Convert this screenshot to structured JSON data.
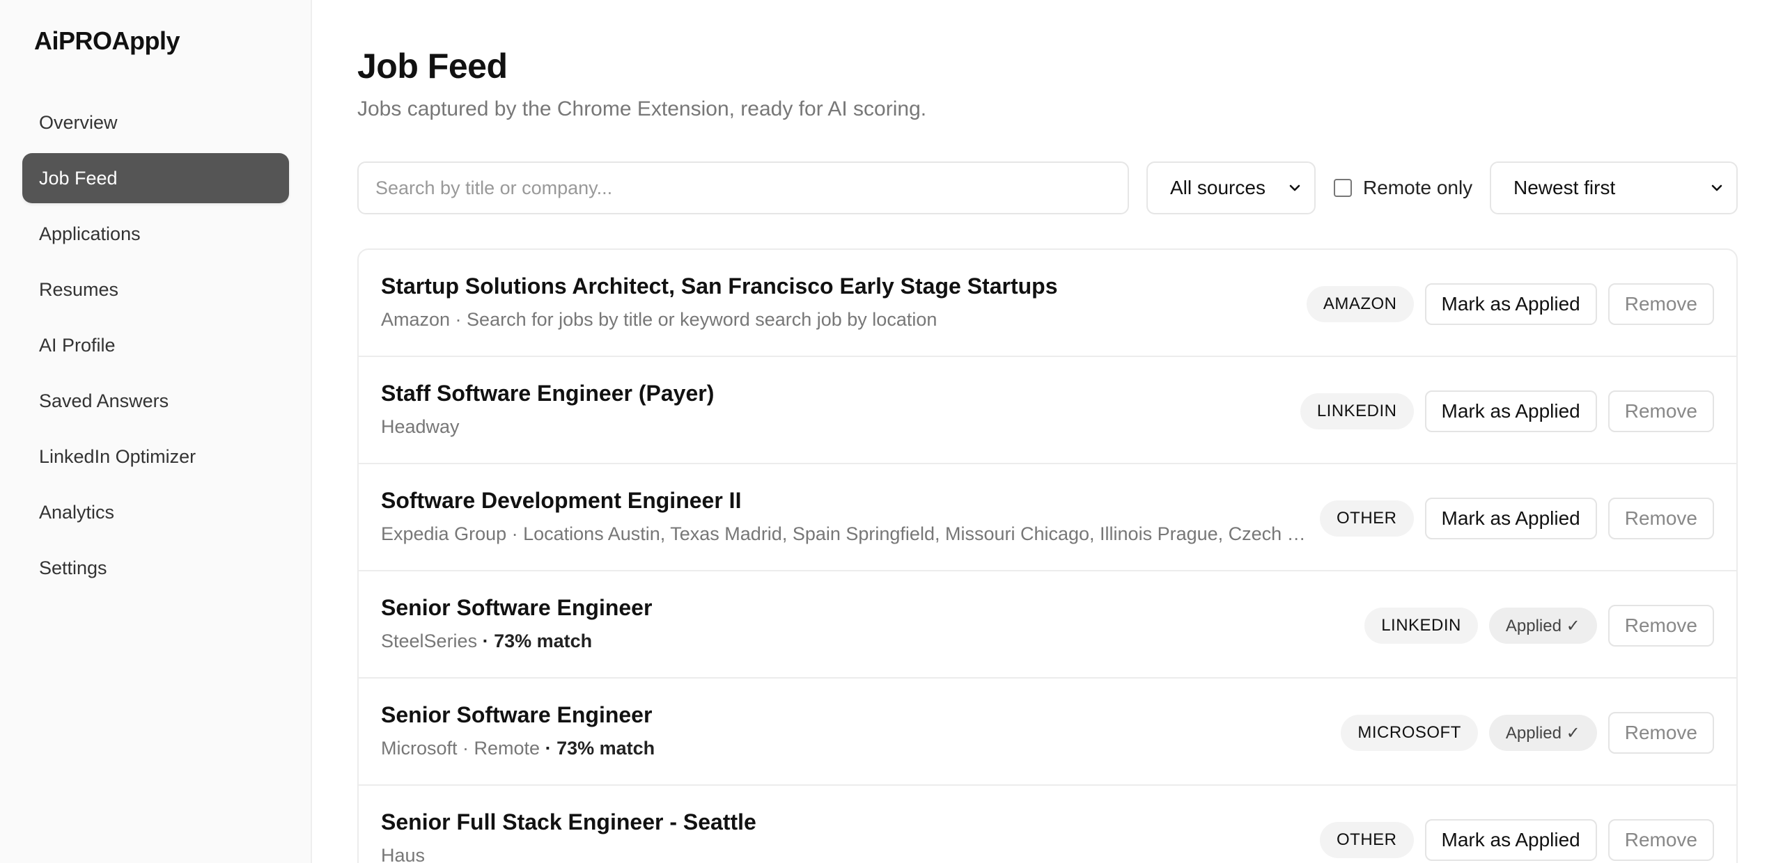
{
  "app": {
    "logo": "AiPROApply"
  },
  "sidebar": {
    "items": [
      {
        "label": "Overview",
        "key": "overview",
        "active": false
      },
      {
        "label": "Job Feed",
        "key": "job-feed",
        "active": true
      },
      {
        "label": "Applications",
        "key": "applications",
        "active": false
      },
      {
        "label": "Resumes",
        "key": "resumes",
        "active": false
      },
      {
        "label": "AI Profile",
        "key": "ai-profile",
        "active": false
      },
      {
        "label": "Saved Answers",
        "key": "saved-answers",
        "active": false
      },
      {
        "label": "LinkedIn Optimizer",
        "key": "linkedin-optimizer",
        "active": false
      },
      {
        "label": "Analytics",
        "key": "analytics",
        "active": false
      },
      {
        "label": "Settings",
        "key": "settings",
        "active": false
      }
    ]
  },
  "page": {
    "title": "Job Feed",
    "subtitle": "Jobs captured by the Chrome Extension, ready for AI scoring."
  },
  "filters": {
    "search_placeholder": "Search by title or company...",
    "search_value": "",
    "source_selected": "All sources",
    "remote_only_label": "Remote only",
    "remote_only_checked": false,
    "sort_selected": "Newest first"
  },
  "actions": {
    "mark_applied_label": "Mark as Applied",
    "applied_label": "Applied ✓",
    "remove_label": "Remove"
  },
  "jobs": [
    {
      "title": "Startup Solutions Architect, San Francisco Early Stage Startups",
      "meta": "Amazon · Search for jobs by title or keyword search job by location",
      "match": "",
      "source": "AMAZON",
      "applied": false
    },
    {
      "title": "Staff Software Engineer (Payer)",
      "meta": "Headway",
      "match": "",
      "source": "LINKEDIN",
      "applied": false
    },
    {
      "title": "Software Development Engineer II",
      "meta": "Expedia Group · Locations Austin, Texas Madrid, Spain Springfield, Missouri Chicago, Illinois Prague, Czech Republic",
      "match": "",
      "source": "OTHER",
      "applied": false
    },
    {
      "title": "Senior Software Engineer",
      "meta": "SteelSeries",
      "match": "· 73% match",
      "source": "LINKEDIN",
      "applied": true
    },
    {
      "title": "Senior Software Engineer",
      "meta": "Microsoft · Remote",
      "match": "· 73% match",
      "source": "MICROSOFT",
      "applied": true
    },
    {
      "title": "Senior Full Stack Engineer - Seattle",
      "meta": "Haus",
      "match": "",
      "source": "OTHER",
      "applied": false
    }
  ]
}
